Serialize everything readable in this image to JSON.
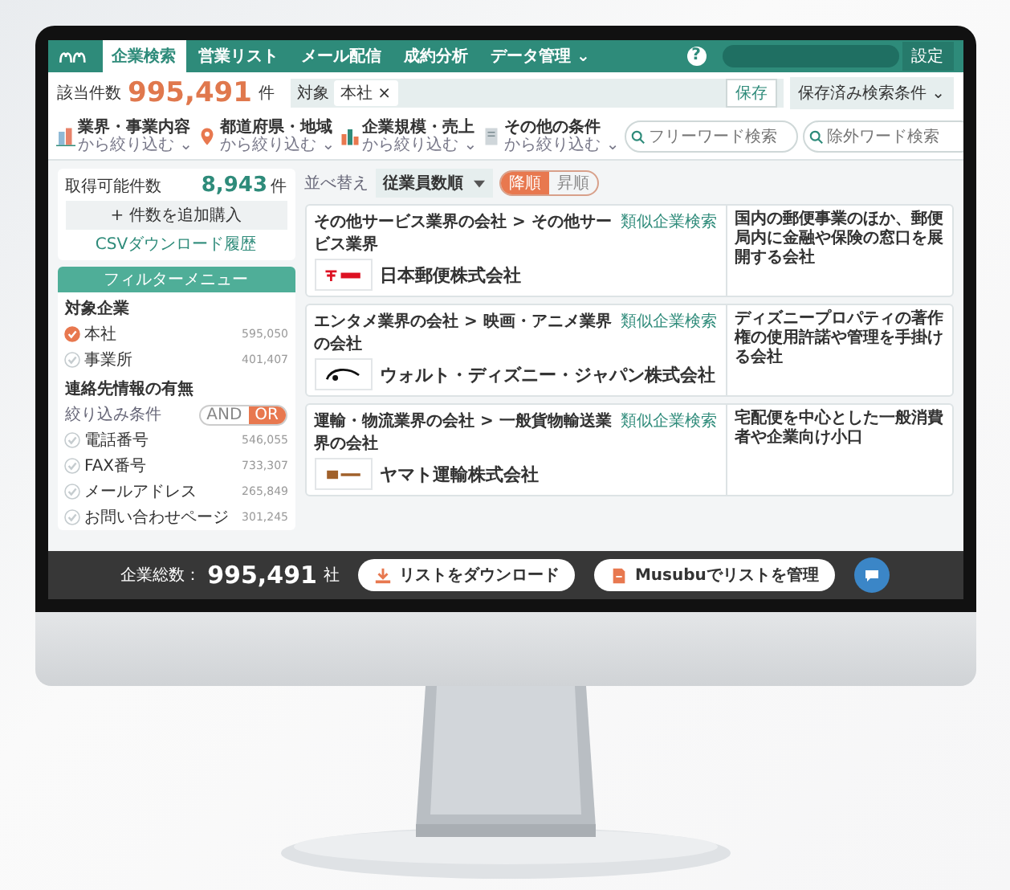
{
  "nav": {
    "tabs": [
      {
        "label": "企業検索",
        "selected": true
      },
      {
        "label": "営業リスト",
        "selected": false
      },
      {
        "label": "メール配信",
        "selected": false
      },
      {
        "label": "成約分析",
        "selected": false
      },
      {
        "label": "データ管理 ⌄",
        "selected": false
      }
    ],
    "help": "?",
    "settings": "設定"
  },
  "summary": {
    "label": "該当件数",
    "count": "995,491",
    "unit": "件",
    "chips": [
      {
        "key": "対象",
        "value": "本社",
        "remove": "×"
      }
    ],
    "save": "保存",
    "saved_searches": "保存済み検索条件 ⌄"
  },
  "categories": [
    {
      "kind": "industry",
      "title": "業界・事業内容",
      "sub": "から絞り込む ⌄"
    },
    {
      "kind": "region",
      "title": "都道府県・地域",
      "sub": "から絞り込む ⌄"
    },
    {
      "kind": "size",
      "title": "企業規模・売上",
      "sub": "から絞り込む ⌄"
    },
    {
      "kind": "other",
      "title": "その他の条件",
      "sub": "から絞り込む ⌄"
    }
  ],
  "search": [
    {
      "placeholder": "フリーワード検索"
    },
    {
      "placeholder": "除外ワード検索"
    }
  ],
  "sidebar": {
    "available": {
      "label": "取得可能件数",
      "count": "8,943",
      "unit": "件"
    },
    "buy_button": "+ 件数を追加購入",
    "csv_link": "CSVダウンロード履歴",
    "filter_title": "フィルターメニュー",
    "sections": [
      {
        "title": "対象企業",
        "items": [
          {
            "label": "本社",
            "count": "595,050",
            "checked": true
          },
          {
            "label": "事業所",
            "count": "401,407",
            "checked": false
          }
        ]
      },
      {
        "title": "連絡先情報の有無",
        "toggle": {
          "label": "絞り込み条件",
          "options": [
            {
              "label": "AND",
              "selected": false
            },
            {
              "label": "OR",
              "selected": true
            }
          ]
        },
        "items": [
          {
            "label": "電話番号",
            "count": "546,055",
            "checked": false
          },
          {
            "label": "FAX番号",
            "count": "733,307",
            "checked": false
          },
          {
            "label": "メールアドレス",
            "count": "265,849",
            "checked": false
          },
          {
            "label": "お問い合わせページ",
            "count": "301,245",
            "checked": false
          }
        ]
      }
    ]
  },
  "sort": {
    "label": "並べ替え",
    "value": "従業員数順",
    "orders": [
      {
        "label": "降順",
        "selected": true
      },
      {
        "label": "昇順",
        "selected": false
      }
    ]
  },
  "results": [
    {
      "kind": "post",
      "category": "その他サービス業界の会社 > その他サービス業界",
      "name": "日本郵便株式会社",
      "similar": "類似企業検索",
      "summary": "国内の郵便事業のほか、郵便局内に金融や保険の窓口を展開する会社"
    },
    {
      "kind": "entertainment",
      "category": "エンタメ業界の会社 > 映画・アニメ業界の会社",
      "name": "ウォルト・ディズニー・ジャパン株式会社",
      "similar": "類似企業検索",
      "summary": "ディズニープロパティの著作権の使用許諾や管理を手掛ける会社"
    },
    {
      "kind": "transport",
      "category": "運輸・物流業界の会社 > 一般貨物輸送業界の会社",
      "name": "ヤマト運輸株式会社",
      "similar": "類似企業検索",
      "summary": "宅配便を中心とした一般消費者や企業向け小口"
    }
  ],
  "bottom_bar": {
    "label": "企業総数：",
    "count": "995,491",
    "unit": "社",
    "download": "リストをダウンロード",
    "manage": "Musubuでリストを管理"
  }
}
